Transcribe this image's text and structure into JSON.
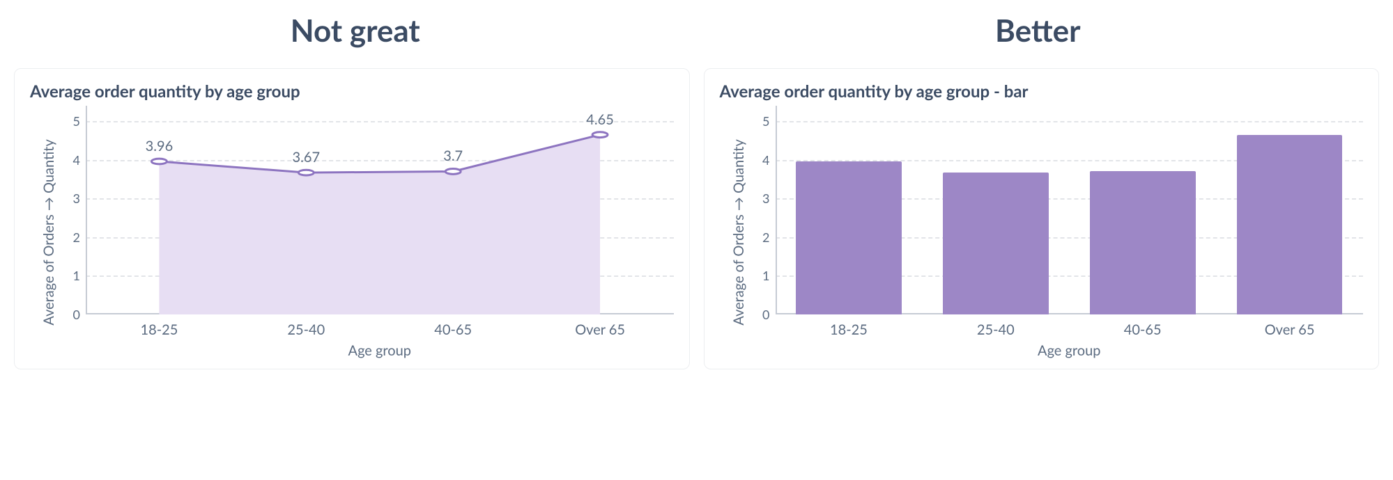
{
  "headers": {
    "left": "Not great",
    "right": "Better"
  },
  "chart_data": [
    {
      "type": "area",
      "title": "Average order quantity by age group",
      "categories": [
        "18-25",
        "25-40",
        "40-65",
        "Over 65"
      ],
      "values": [
        3.96,
        3.67,
        3.7,
        4.65
      ],
      "xlabel": "Age group",
      "ylabel": "Average of Orders → Quantity",
      "yticks": [
        0,
        1,
        2,
        3,
        4,
        5
      ],
      "ylim": [
        0,
        5.4
      ],
      "show_point_labels": true,
      "color": "#8d74c0",
      "fill": "#e7def3"
    },
    {
      "type": "bar",
      "title": "Average order quantity by age group - bar",
      "categories": [
        "18-25",
        "25-40",
        "40-65",
        "Over 65"
      ],
      "values": [
        3.96,
        3.67,
        3.7,
        4.65
      ],
      "xlabel": "Age group",
      "ylabel": "Average of Orders → Quantity",
      "yticks": [
        0,
        1,
        2,
        3,
        4,
        5
      ],
      "ylim": [
        0,
        5.4
      ],
      "show_point_labels": false,
      "color": "#9d87c6"
    }
  ]
}
